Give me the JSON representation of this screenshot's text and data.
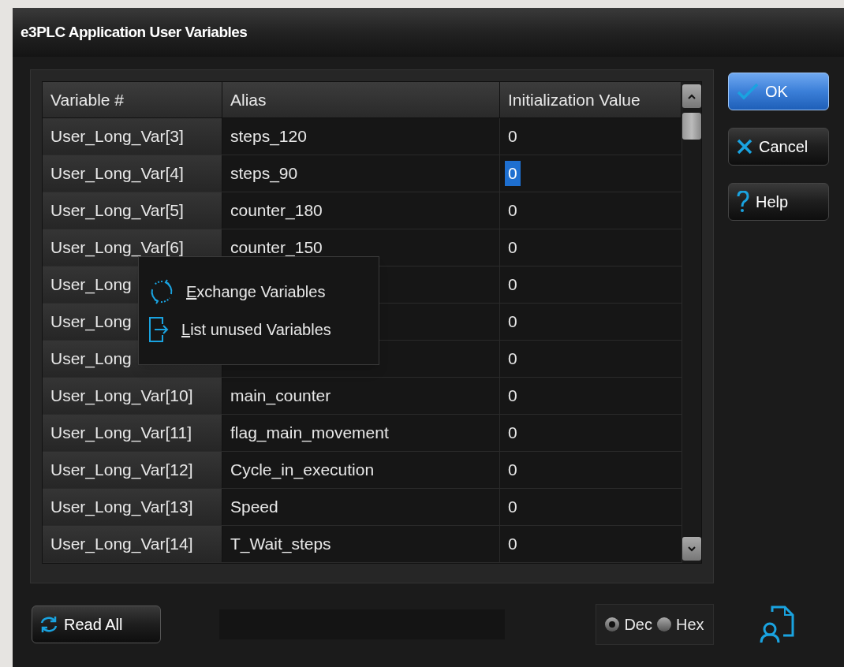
{
  "window": {
    "title": "e3PLC Application User Variables"
  },
  "table": {
    "columns": [
      "Variable #",
      "Alias",
      "Initialization Value"
    ],
    "rows": [
      {
        "variable": "User_Long_Var[3]",
        "alias": "steps_120",
        "init": "0",
        "selected": false
      },
      {
        "variable": "User_Long_Var[4]",
        "alias": "steps_90",
        "init": "0",
        "selected": true
      },
      {
        "variable": "User_Long_Var[5]",
        "alias": "counter_180",
        "init": "0",
        "selected": false
      },
      {
        "variable": "User_Long_Var[6]",
        "alias": "counter_150",
        "init": "0",
        "selected": false
      },
      {
        "variable": "User_Long",
        "init": "0",
        "selected": false
      },
      {
        "variable": "User_Long",
        "init": "0",
        "selected": false
      },
      {
        "variable": "User_Long",
        "init": "0",
        "selected": false
      },
      {
        "variable": "User_Long_Var[10]",
        "alias": "main_counter",
        "init": "0",
        "selected": false
      },
      {
        "variable": "User_Long_Var[11]",
        "alias": "flag_main_movement",
        "init": "0",
        "selected": false
      },
      {
        "variable": "User_Long_Var[12]",
        "alias": "Cycle_in_execution",
        "init": "0",
        "selected": false
      },
      {
        "variable": "User_Long_Var[13]",
        "alias": "Speed",
        "init": "0",
        "selected": false
      },
      {
        "variable": "User_Long_Var[14]",
        "alias": "T_Wait_steps",
        "init": "0",
        "selected": false
      }
    ]
  },
  "context_menu": {
    "items": [
      {
        "kind": "exchange",
        "label": "Exchange Variables"
      },
      {
        "kind": "list",
        "label": "List unused Variables"
      }
    ]
  },
  "buttons": [
    {
      "kind": "ok",
      "label": "OK",
      "selected": true
    },
    {
      "kind": "cancel",
      "label": "Cancel",
      "selected": false
    },
    {
      "kind": "help",
      "label": "Help",
      "selected": false
    }
  ],
  "read_all": {
    "label": "Read All"
  },
  "radix": [
    {
      "label": "Dec",
      "selected": true
    },
    {
      "label": "Hex",
      "selected": false
    }
  ]
}
